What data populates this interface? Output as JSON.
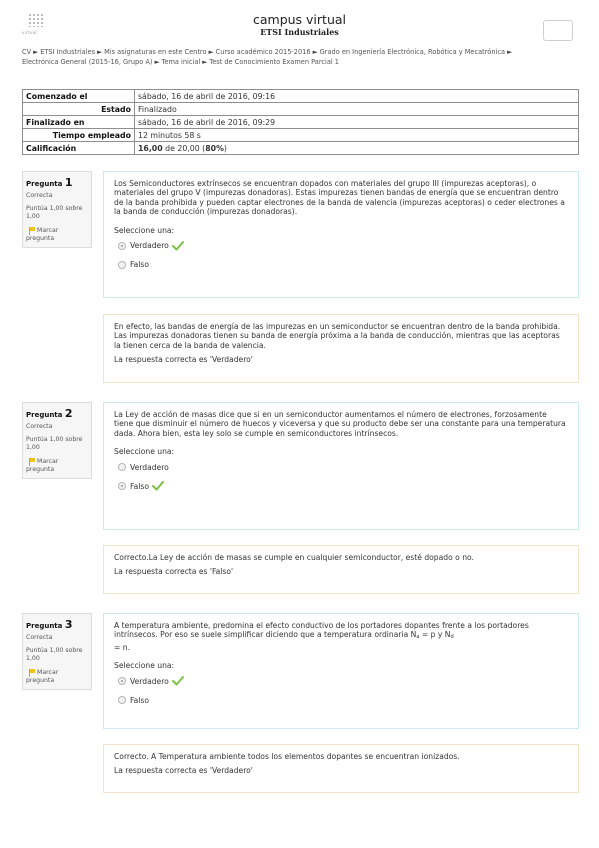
{
  "header": {
    "logo_caption": "virtual",
    "site_title": "campus virtual",
    "site_subtitle": "ETSI Industriales"
  },
  "breadcrumb": [
    "CV",
    "ETSI Industriales",
    "Mis asignaturas en este Centro",
    "Curso académico 2015-2016",
    "Grado en Ingeniería Electrónica, Robótica y Mecatrónica",
    "Electrónica General (2015-16, Grupo A)",
    "Tema inicial",
    "Test de Conocimiento Examen Parcial 1"
  ],
  "summary": {
    "started_label": "Comenzado el",
    "started_value": "sábado, 16 de abril de 2016, 09:16",
    "state_label": "Estado",
    "state_value": "Finalizado",
    "finished_label": "Finalizado en",
    "finished_value": "sábado, 16 de abril de 2016, 09:29",
    "time_label": "Tiempo empleado",
    "time_value": "12 minutos 58 s",
    "grade_label": "Calificación",
    "grade_score": "16,00",
    "grade_of": "de 20,00 (",
    "grade_percent": "80%",
    "grade_close": ")"
  },
  "questions": [
    {
      "label": "Pregunta",
      "number": "1",
      "state": "Correcta",
      "mark": "Puntúa 1,00 sobre 1,00",
      "flag": "Marcar pregunta",
      "text": "Los Semiconductores extrínsecos se encuentran dopados con materiales del grupo III (impurezas aceptoras), o materiales del grupo V (impurezas donadoras). Estas impurezas tienen bandas de energía que se encuentran dentro de la banda prohibida y pueden captar electrones de la banda de valencia (impurezas aceptoras) o ceder electrones a la banda de conducción (impurezas donadoras).",
      "prompt": "Seleccione una:",
      "options": [
        "Verdadero",
        "Falso"
      ],
      "selected": 0,
      "feedback": "En efecto, las bandas de energía de las impurezas en un semiconductor se encuentran dentro de la banda prohibida. Las impurezas donadoras tienen su banda de energía próxima a la banda de conducción, mientras que las aceptoras la tienen cerca de la banda de valencia.",
      "right_answer": "La respuesta correcta es 'Verdadero'"
    },
    {
      "label": "Pregunta",
      "number": "2",
      "state": "Correcta",
      "mark": "Puntúa 1,00 sobre 1,00",
      "flag": "Marcar pregunta",
      "text": "La Ley de acción de masas dice que si en un semiconductor aumentamos el número de electrones, forzosamente tiene que disminuir el número de huecos y viceversa y que su producto debe ser una constante para una temperatura dada. Ahora bien, esta ley solo se cumple en semiconductores intrínsecos.",
      "prompt": "Seleccione una:",
      "options": [
        "Verdadero",
        "Falso"
      ],
      "selected": 1,
      "feedback": "Correcto.La Ley de acción de masas se cumple en cualquier semiconductor, esté dopado o no.",
      "right_answer": "La respuesta correcta es 'Falso'"
    },
    {
      "label": "Pregunta",
      "number": "3",
      "state": "Correcta",
      "mark": "Puntúa 1,00 sobre 1,00",
      "flag": "Marcar pregunta",
      "text_main": "A temperatura ambiente, predomina el efecto conductivo de los portadores dopantes frente a los portadores intrínsecos. Por eso se suele simplificar diciendo que a temperatura ordinaria N",
      "text_sub_a": "a",
      "text_mid": " = p y N",
      "text_sub_d": "d",
      "text_end": " = n.",
      "prompt": "Seleccione una:",
      "options": [
        "Verdadero",
        "Falso"
      ],
      "selected": 0,
      "feedback": "Correcto. A Temperatura ambiente todos los elementos dopantes se encuentran ionizados.",
      "right_answer": "La respuesta correcta es 'Verdadero'"
    }
  ],
  "colors": {
    "question_border": "#cfe9f3",
    "feedback_border": "#f3e3c8",
    "check_green": "#7cc242",
    "flag_yellow": "#f0c419"
  }
}
